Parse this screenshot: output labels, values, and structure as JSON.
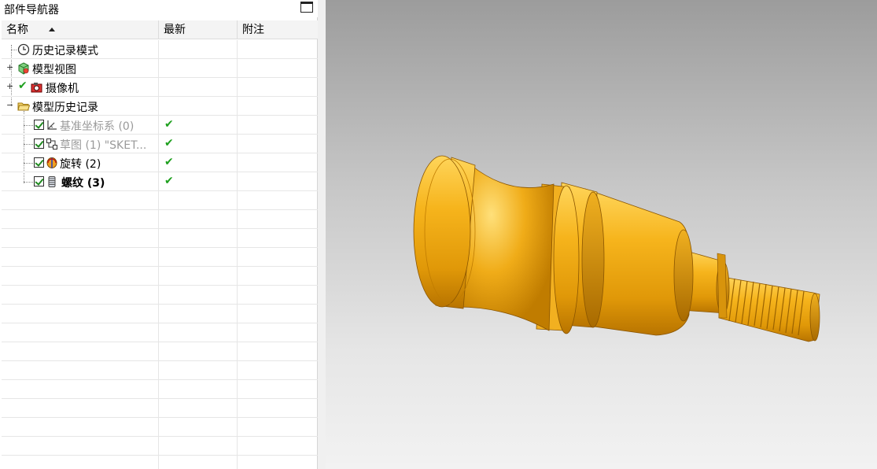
{
  "panel": {
    "title": "部件导航器"
  },
  "columns": {
    "name": "名称",
    "latest": "最新",
    "note": "附注"
  },
  "tree": {
    "history_mode": "历史记录模式",
    "model_views": "模型视图",
    "cameras": "摄像机",
    "model_history": "模型历史记录",
    "features": [
      {
        "label": "基准坐标系 (0)",
        "latest": "✔"
      },
      {
        "label": "草图 (1) \"SKET...",
        "latest": "✔"
      },
      {
        "label": "旋转 (2)",
        "latest": "✔"
      },
      {
        "label": "螺纹 (3)",
        "latest": "✔"
      }
    ]
  },
  "colors": {
    "part": "#f2b318",
    "check": "#1ea01e"
  }
}
